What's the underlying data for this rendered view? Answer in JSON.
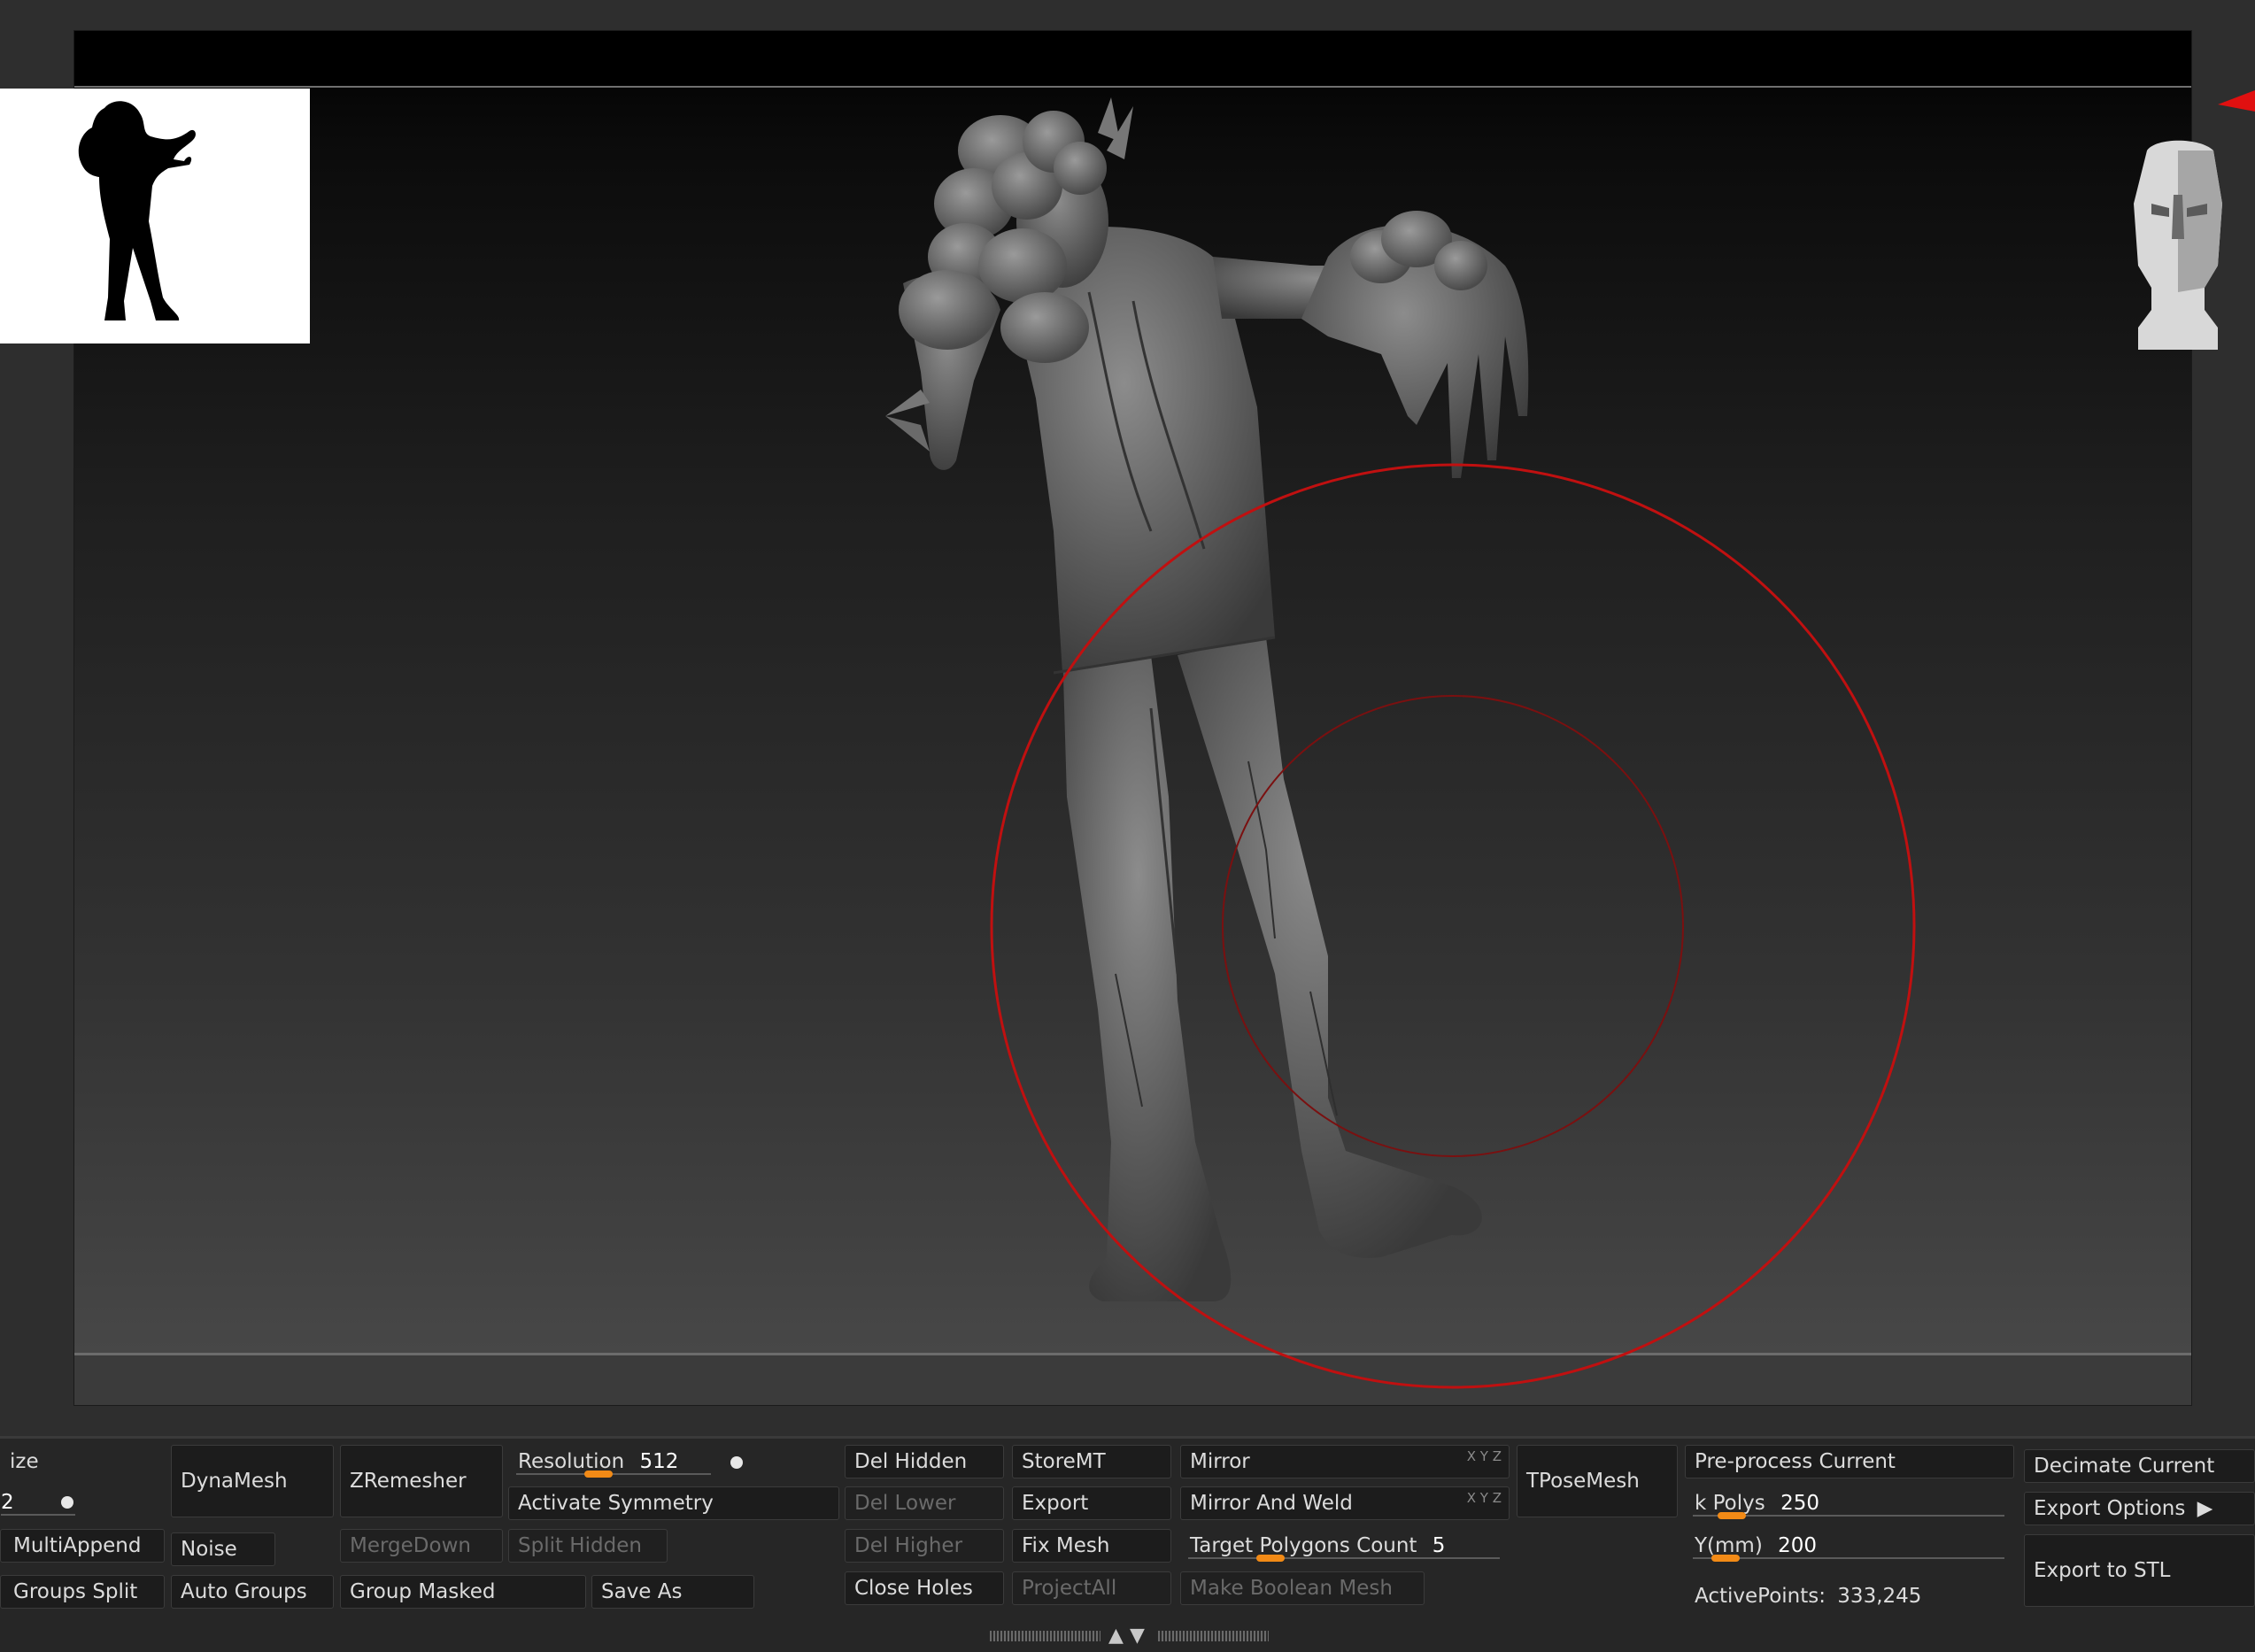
{
  "thumbnail": {
    "description": "Black silhouette of zombie figure"
  },
  "viewport": {
    "model": "zombie-sculpt",
    "brush_color": "#c01010"
  },
  "panel": {
    "col0": {
      "size_label": "ize",
      "size_value": "2",
      "multiappend": "MultiAppend",
      "groups_split": "Groups Split"
    },
    "col1": {
      "dynamesh": "DynaMesh",
      "noise": "Noise",
      "auto_groups": "Auto Groups"
    },
    "col2": {
      "zremesher": "ZRemesher",
      "mergedown": "MergeDown",
      "group_masked": "Group Masked"
    },
    "col3": {
      "resolution_label": "Resolution",
      "resolution_value": "512",
      "resolution_level": 0.35,
      "activate_symmetry": "Activate Symmetry",
      "split_hidden": "Split Hidden",
      "save_as": "Save As"
    },
    "col4": {
      "del_hidden": "Del Hidden",
      "del_lower": "Del Lower",
      "del_higher": "Del Higher",
      "close_holes": "Close Holes"
    },
    "col5": {
      "storemt": "StoreMT",
      "export": "Export",
      "fix_mesh": "Fix Mesh",
      "projectall": "ProjectAll"
    },
    "col6": {
      "mirror": "Mirror",
      "mirror_and_weld": "Mirror And Weld",
      "xyz": "X Y Z",
      "target_label": "Target Polygons Count",
      "target_value": "5",
      "target_level": 0.22,
      "make_boolean": "Make Boolean Mesh"
    },
    "col7": {
      "tposemesh": "TPoseMesh"
    },
    "col8": {
      "preprocess": "Pre-process Current",
      "kpolys_label": "k Polys",
      "kpolys_value": "250",
      "kpolys_level": 0.08,
      "ymm_label": "Y(mm)",
      "ymm_value": "200",
      "ymm_level": 0.06,
      "active_points_label": "ActivePoints:",
      "active_points_value": "333,245"
    },
    "col9": {
      "decimate": "Decimate Current",
      "export_options": "Export Options",
      "export_stl": "Export to STL"
    }
  },
  "colors": {
    "accent_orange": "#f28a16",
    "brush_red": "#c01010"
  }
}
